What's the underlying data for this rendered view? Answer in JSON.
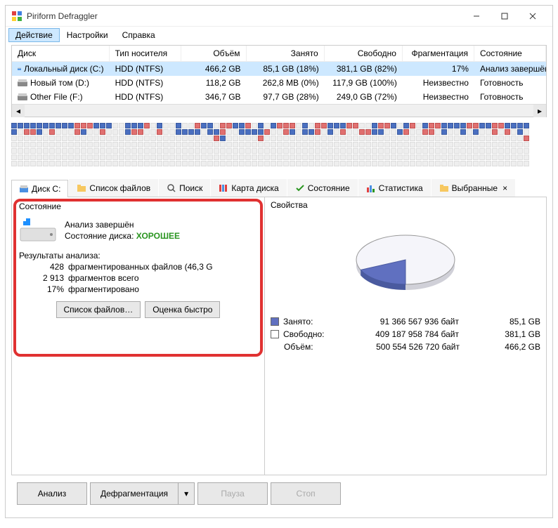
{
  "window": {
    "title": "Piriform Defraggler"
  },
  "menu": {
    "action": "Действие",
    "settings": "Настройки",
    "help": "Справка"
  },
  "disks": {
    "headers": {
      "name": "Диск",
      "media": "Тип носителя",
      "size": "Объём",
      "used": "Занято",
      "free": "Свободно",
      "frag": "Фрагментация",
      "state": "Состояние"
    },
    "rows": [
      {
        "name": "Локальный диск (C:)",
        "media": "HDD (NTFS)",
        "size": "466,2 GB",
        "used": "85,1 GB (18%)",
        "free": "381,1 GB (82%)",
        "frag": "17%",
        "state": "Анализ завершён",
        "selected": true,
        "icon": "blue"
      },
      {
        "name": "Новый том (D:)",
        "media": "HDD (NTFS)",
        "size": "118,2 GB",
        "used": "262,8 MB (0%)",
        "free": "117,9 GB (100%)",
        "frag": "Неизвестно",
        "state": "Готовность",
        "selected": false,
        "icon": "gray"
      },
      {
        "name": "Other File (F:)",
        "media": "HDD (NTFS)",
        "size": "346,7 GB",
        "used": "97,7 GB (28%)",
        "free": "249,0 GB (72%)",
        "frag": "Неизвестно",
        "state": "Готовность",
        "selected": false,
        "icon": "gray"
      }
    ]
  },
  "tabs": {
    "items": [
      {
        "label": "Диск C:",
        "icon": "disk"
      },
      {
        "label": "Список файлов",
        "icon": "folder"
      },
      {
        "label": "Поиск",
        "icon": "search"
      },
      {
        "label": "Карта диска",
        "icon": "map"
      },
      {
        "label": "Состояние",
        "icon": "check"
      },
      {
        "label": "Статистика",
        "icon": "stats"
      },
      {
        "label": "Выбранные",
        "icon": "folder",
        "closable": true
      }
    ],
    "active": 0
  },
  "status": {
    "heading": "Состояние",
    "done": "Анализ завершён",
    "disk_state_label": "Состояние диска:",
    "disk_state_value": "ХОРОШЕЕ",
    "results_heading": "Результаты анализа:",
    "frag_files_count": "428",
    "frag_files_text": "фрагментированных файлов (46,3 G",
    "frag_total_count": "2 913",
    "frag_total_text": "фрагментов всего",
    "frag_pct_count": "17%",
    "frag_pct_text": "фрагментировано",
    "btn_list": "Список файлов…",
    "btn_eval": "Оценка быстро"
  },
  "props": {
    "heading": "Свойства",
    "used_label": "Занято:",
    "used_bytes": "91 366 567 936 байт",
    "used_gb": "85,1 GB",
    "free_label": "Свободно:",
    "free_bytes": "409 187 958 784 байт",
    "free_gb": "381,1 GB",
    "size_label": "Объём:",
    "size_bytes": "500 554 526 720 байт",
    "size_gb": "466,2 GB"
  },
  "chart_data": {
    "type": "pie",
    "title": "Свойства",
    "series": [
      {
        "name": "Занято",
        "value": 91366567936,
        "pct": 18.25
      },
      {
        "name": "Свободно",
        "value": 409187958784,
        "pct": 81.75
      }
    ],
    "total": 500554526720,
    "unit": "байт"
  },
  "bottom": {
    "analyze": "Анализ",
    "defrag": "Дефрагментация",
    "pause": "Пауза",
    "stop": "Стоп"
  }
}
